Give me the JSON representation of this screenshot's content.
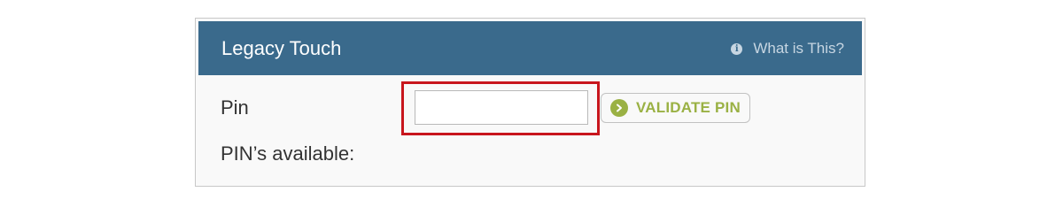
{
  "panel": {
    "title": "Legacy Touch",
    "help_link": "What is This?",
    "info_icon": "info-icon"
  },
  "form": {
    "pin_label": "Pin",
    "pin_value": "",
    "pin_placeholder": "",
    "validate_button": "VALIDATE PIN",
    "validate_icon": "arrow-right-circle-icon",
    "available_label": "PIN’s available:"
  },
  "colors": {
    "header_bg": "#3a6a8c",
    "accent_green": "#9ab144",
    "highlight_red": "#c8161d"
  }
}
